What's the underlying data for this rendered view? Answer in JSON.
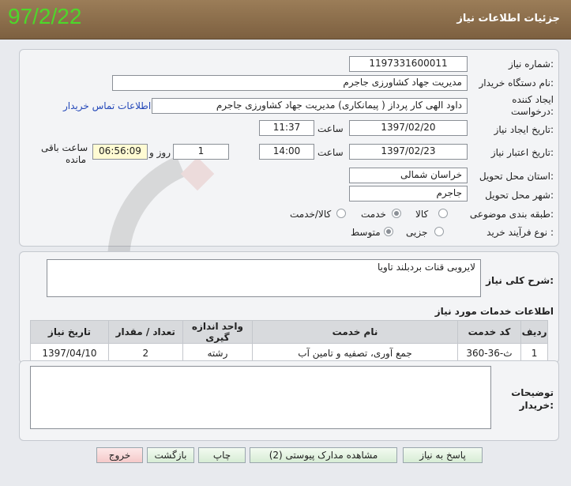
{
  "header": {
    "title": "جزئیات اطلاعات نیاز",
    "date": "97/2/22"
  },
  "form": {
    "need_number_label": "شماره نیاز:",
    "need_number": "1197331600011",
    "buyer_org_label": "نام دستگاه خریدار:",
    "buyer_org": "مدیریت جهاد کشاورزی جاجرم",
    "creator_label_1": "ایجاد کننده",
    "creator_label_2": "درخواست:",
    "creator": "داود  الهی کار پرداز ( پیمانکاری) مدیریت جهاد کشاورزی جاجرم",
    "contact_link": "اطلاعات تماس خریدار",
    "created_date_label": "تاریخ ایجاد نیاز:",
    "created_date": "1397/02/20",
    "time_label": "ساعت",
    "created_time": "11:37",
    "valid_date_label": "تاریخ اعتبار نیاز:",
    "valid_date": "1397/02/23",
    "valid_time": "14:00",
    "days": "1",
    "days_label": "روز و",
    "remaining": "06:56:09",
    "remaining_label_1": "ساعت باقی",
    "remaining_label_2": "مانده",
    "province_label": "استان محل تحویل:",
    "province": "خراسان شمالی",
    "city_label": "شهر محل تحویل:",
    "city": "جاجرم",
    "category_label": "طبقه بندی موضوعی:",
    "category_options": [
      "کالا",
      "خدمت",
      "کالا/خدمت"
    ],
    "category_selected": "خدمت",
    "process_label": "نوع فرآیند خرید :",
    "process_options": [
      "جزیی",
      "متوسط"
    ],
    "process_selected": "متوسط"
  },
  "description": {
    "label": "شرح کلی نیاز:",
    "text": "لایروبی قنات بردبلند تاویا"
  },
  "services": {
    "title": "اطلاعات خدمات مورد نیاز",
    "columns": [
      "ردیف",
      "کد خدمت",
      "نام خدمت",
      "واحد اندازه گیری",
      "تعداد / مقدار",
      "تاریخ نیاز"
    ],
    "rows": [
      [
        "1",
        "ث-36-360",
        "جمع آوری، تصفیه و تامین آب",
        "رشته",
        "2",
        "1397/04/10"
      ]
    ]
  },
  "buyer_notes": {
    "label_1": "توضیحات",
    "label_2": "خریدار:",
    "text": ""
  },
  "buttons": {
    "reply": "پاسخ به نیاز",
    "attachments": "مشاهده مدارک پیوستی (2)",
    "print": "چاپ",
    "back": "بازگشت",
    "exit": "خروج"
  },
  "colors": {
    "header": "#8b6d4b",
    "date": "#4dd82a",
    "link": "#2347b8"
  }
}
